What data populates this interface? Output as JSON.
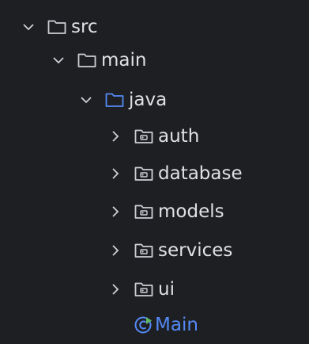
{
  "colors": {
    "background": "#1e1f22",
    "text": "#dfe1e5",
    "icon": "#ced0d6",
    "accent": "#548af7"
  },
  "tree": {
    "src": {
      "label": "src",
      "icon": "folder-icon",
      "state": "expanded"
    },
    "main": {
      "label": "main",
      "icon": "folder-icon",
      "state": "expanded"
    },
    "java": {
      "label": "java",
      "icon": "source-root-folder-icon",
      "state": "expanded"
    },
    "packages": [
      {
        "label": "auth",
        "icon": "package-icon",
        "state": "collapsed"
      },
      {
        "label": "database",
        "icon": "package-icon",
        "state": "collapsed"
      },
      {
        "label": "models",
        "icon": "package-icon",
        "state": "collapsed"
      },
      {
        "label": "services",
        "icon": "package-icon",
        "state": "collapsed"
      },
      {
        "label": "ui",
        "icon": "package-icon",
        "state": "collapsed"
      }
    ],
    "main_class": {
      "label": "Main",
      "icon": "java-class-runnable-icon"
    }
  }
}
